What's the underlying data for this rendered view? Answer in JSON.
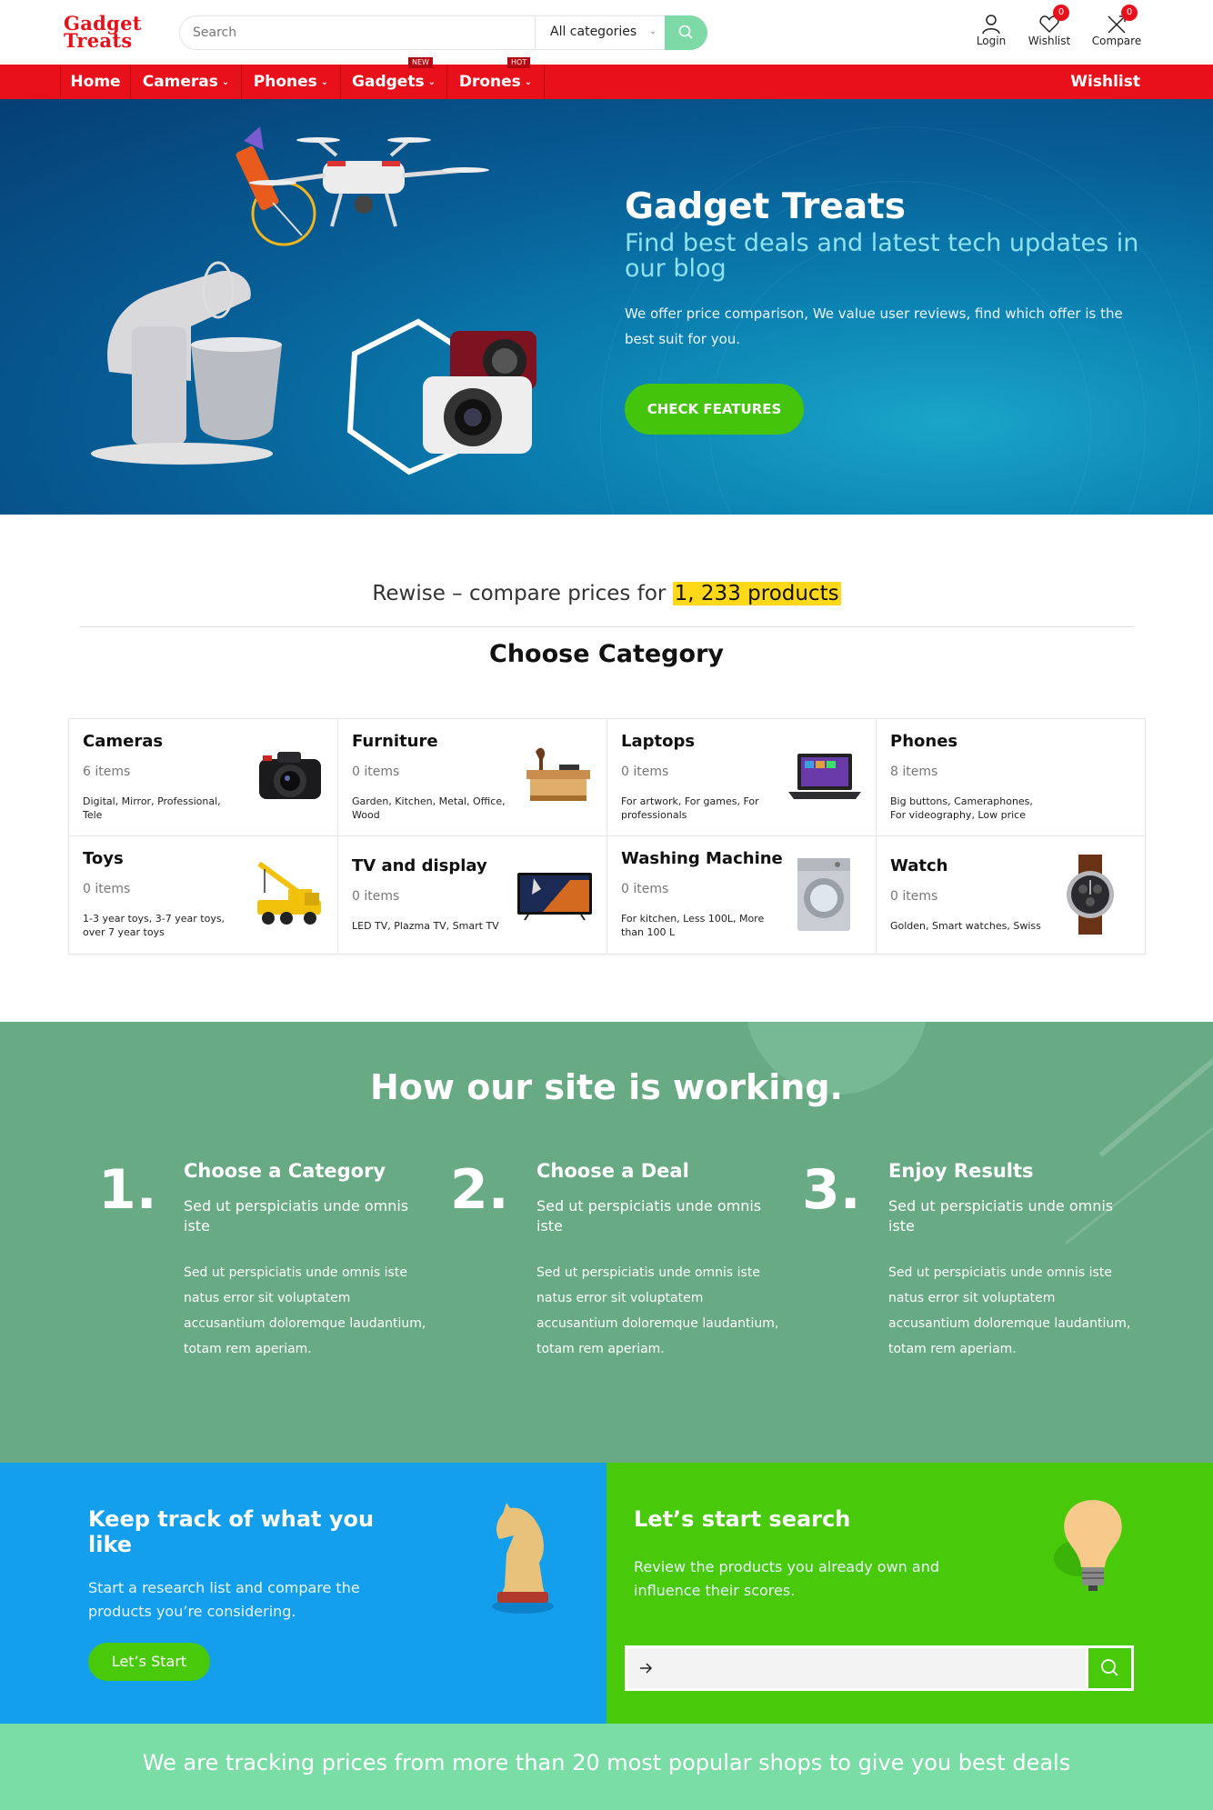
{
  "header": {
    "logo_line1": "Gadget",
    "logo_line2": "Treats",
    "search_placeholder": "Search",
    "category_select": "All categories",
    "login_label": "Login",
    "wishlist_label": "Wishlist",
    "wishlist_count": "0",
    "compare_label": "Compare",
    "compare_count": "0"
  },
  "nav": {
    "items": [
      {
        "label": "Home"
      },
      {
        "label": "Cameras"
      },
      {
        "label": "Phones"
      },
      {
        "label": "Gadgets",
        "tag": "NEW"
      },
      {
        "label": "Drones",
        "tag": "HOT"
      }
    ],
    "wishlist": "Wishlist"
  },
  "hero": {
    "title": "Gadget Treats",
    "subtitle": "Find best deals and latest tech updates in our blog",
    "text": "We offer price comparison, We value user reviews, find which offer is the best suit for you.",
    "button": "CHECK FEATURES"
  },
  "compare": {
    "prefix": "Rewise – compare prices for",
    "highlight": "1, 233 products",
    "heading": "Choose Category"
  },
  "categories": [
    {
      "name": "Cameras",
      "count": "6 items",
      "tags": "Digital, Mirror, Professional, Tele",
      "icon": "camera-icon"
    },
    {
      "name": "Furniture",
      "count": "0 items",
      "tags": "Garden, Kitchen, Metal, Office, Wood",
      "icon": "furniture-icon"
    },
    {
      "name": "Laptops",
      "count": "0 items",
      "tags": "For artwork, For games, For professionals",
      "icon": "laptop-icon"
    },
    {
      "name": "Phones",
      "count": "8 items",
      "tags": "Big buttons, Cameraphones, For videography, Low price",
      "icon": "phone-icon"
    },
    {
      "name": "Toys",
      "count": "0 items",
      "tags": "1-3 year toys, 3-7 year toys, over 7 year toys",
      "icon": "toy-crane-icon"
    },
    {
      "name": "TV and display",
      "count": "0 items",
      "tags": "LED TV, Plazma TV, Smart TV",
      "icon": "tv-icon"
    },
    {
      "name": "Washing Machine",
      "count": "0 items",
      "tags": "For kitchen, Less 100L, More than 100 L",
      "icon": "washing-machine-icon"
    },
    {
      "name": "Watch",
      "count": "0 items",
      "tags": "Golden, Smart watches, Swiss",
      "icon": "watch-icon"
    }
  ],
  "how": {
    "title": "How our site is working.",
    "steps": [
      {
        "num": "1.",
        "title": "Choose a Category",
        "sub": "Sed ut perspiciatis unde omnis iste",
        "text": "Sed ut perspiciatis unde omnis iste natus error sit voluptatem accusantium doloremque laudantium, totam rem aperiam."
      },
      {
        "num": "2.",
        "title": "Choose a Deal",
        "sub": "Sed ut perspiciatis unde omnis iste",
        "text": "Sed ut perspiciatis unde omnis iste natus error sit voluptatem accusantium doloremque laudantium, totam rem aperiam."
      },
      {
        "num": "3.",
        "title": "Enjoy Results",
        "sub": "Sed ut perspiciatis unde omnis iste",
        "text": "Sed ut perspiciatis unde omnis iste natus error sit voluptatem accusantium doloremque laudantium, totam rem aperiam."
      }
    ]
  },
  "track_panel": {
    "title": "Keep track of what you like",
    "text": "Start a research list and compare the products you’re considering.",
    "button": "Let’s Start"
  },
  "search_panel": {
    "title": "Let’s start search",
    "text": "Review the products you already own and influence their scores.",
    "input_value": ""
  },
  "footer_banner": {
    "text": "We are tracking prices from more than 20 most popular shops to give you best deals"
  },
  "colors": {
    "brand_red": "#e8101a",
    "accent_green": "#48c90a",
    "how_green": "#67aa84",
    "panel_blue": "#139fec",
    "banner_mint": "#7bdda6",
    "highlight_yellow": "#ffd81a"
  }
}
